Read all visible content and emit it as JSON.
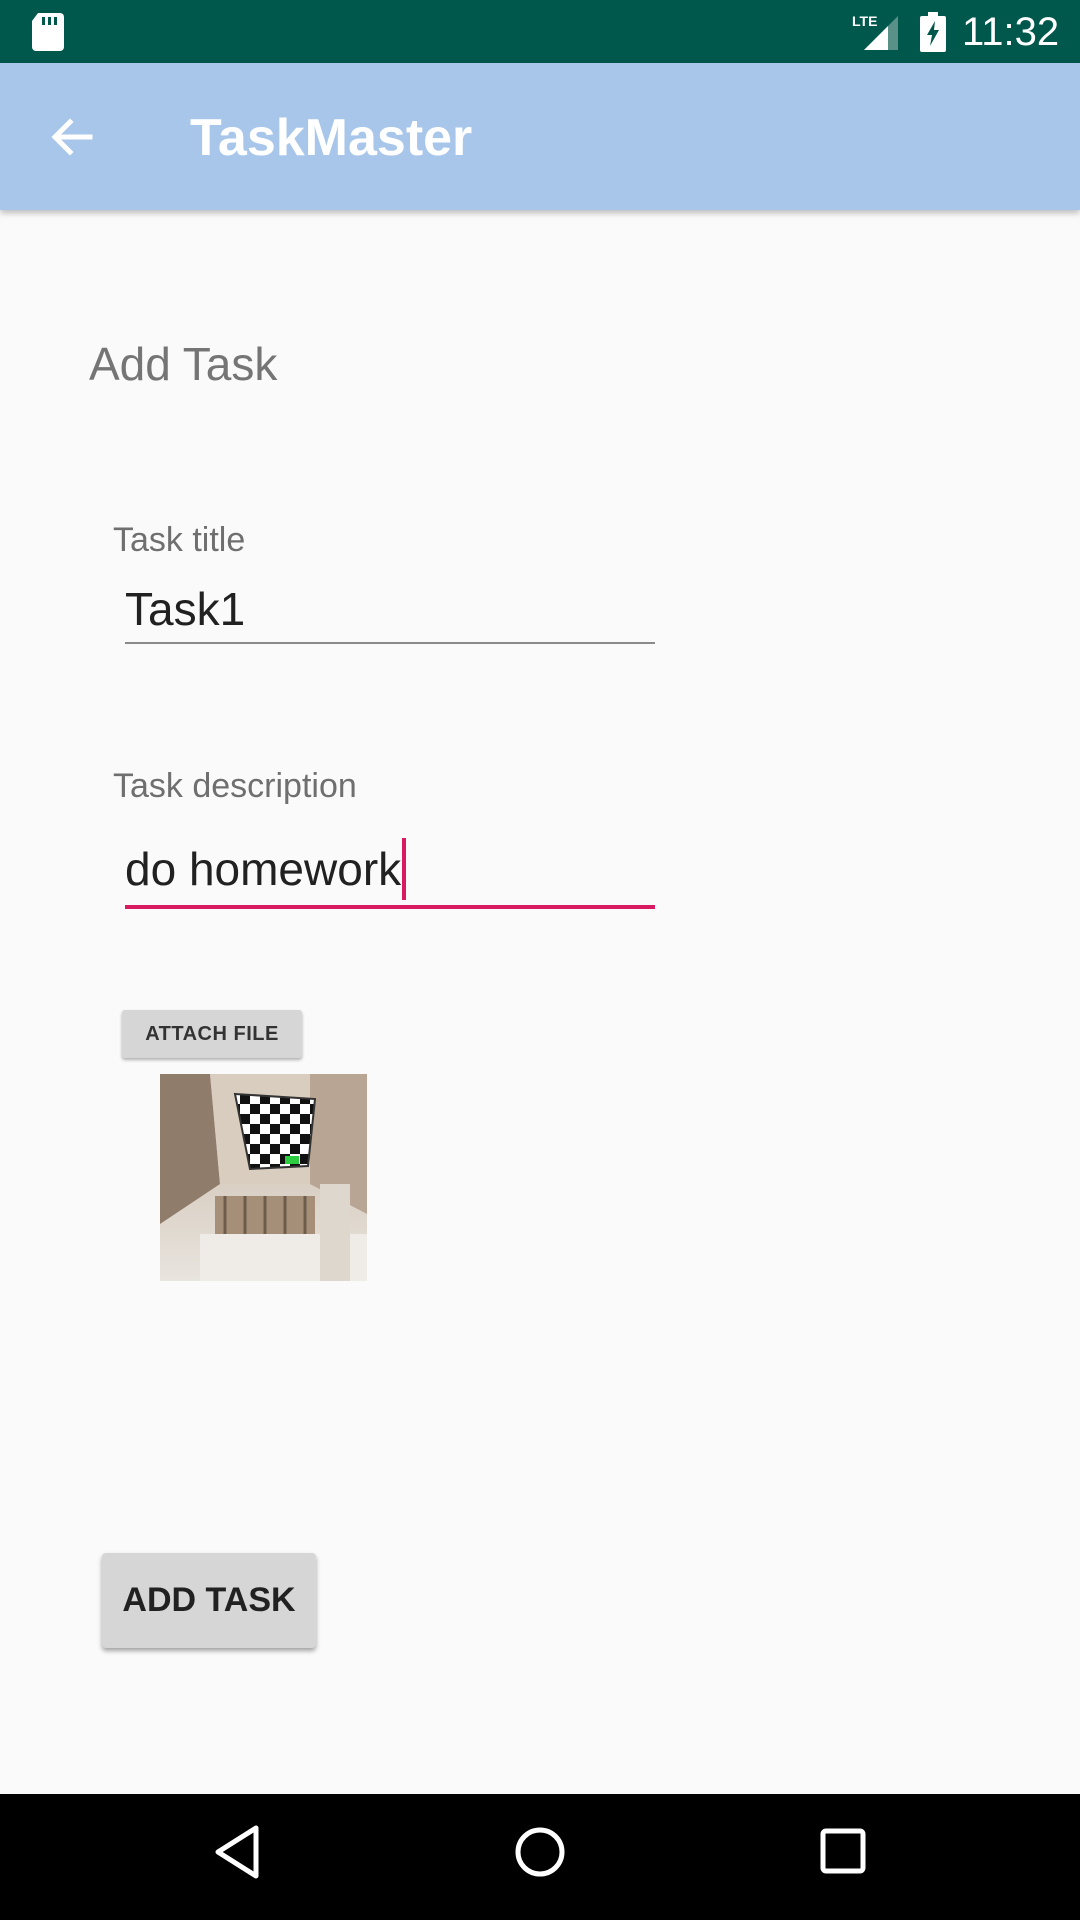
{
  "status_bar": {
    "network": "LTE",
    "time": "11:32",
    "icons": [
      "sd-card-icon",
      "lte-signal-icon",
      "battery-charging-icon"
    ]
  },
  "app_bar": {
    "title": "TaskMaster",
    "back_icon": "arrow-back-icon",
    "background": "#a7c6ea"
  },
  "form": {
    "heading": "Add Task",
    "title_field": {
      "label": "Task title",
      "value": "Task1"
    },
    "description_field": {
      "label": "Task description",
      "value": "do homework",
      "focused": true
    },
    "attach_button": "ATTACH FILE",
    "add_button": "ADD TASK"
  },
  "nav_bar": {
    "icons": [
      "back-triangle-icon",
      "home-circle-icon",
      "recents-square-icon"
    ]
  },
  "colors": {
    "status_bar": "#00574b",
    "accent": "#d81b60",
    "button_bg": "#d6d6d6"
  }
}
